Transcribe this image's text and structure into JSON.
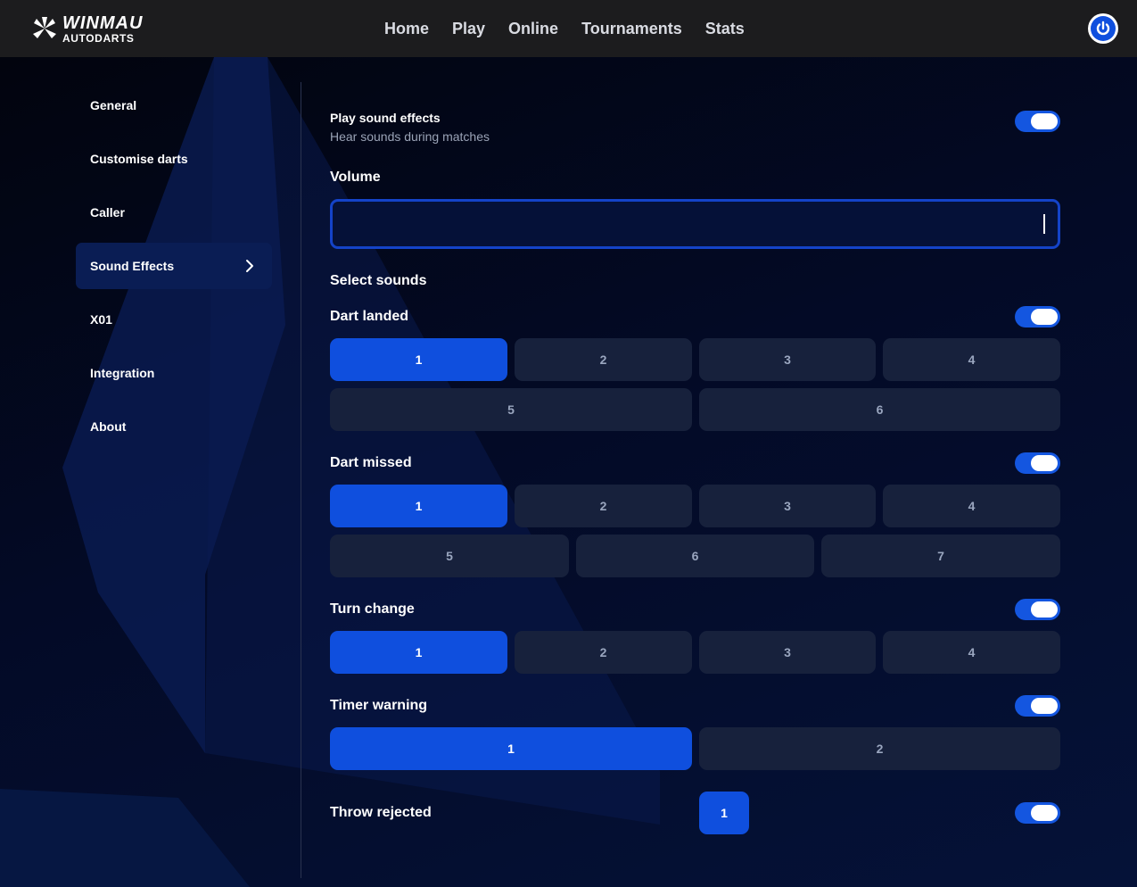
{
  "header": {
    "brand": "WINMAU",
    "brand_sub": "AUTODARTS",
    "nav": [
      "Home",
      "Play",
      "Online",
      "Tournaments",
      "Stats"
    ]
  },
  "sidebar": {
    "items": [
      {
        "label": "General"
      },
      {
        "label": "Customise darts"
      },
      {
        "label": "Caller"
      },
      {
        "label": "Sound Effects",
        "active": true
      },
      {
        "label": "X01"
      },
      {
        "label": "Integration"
      },
      {
        "label": "About"
      }
    ]
  },
  "settings": {
    "play_sound_effects": {
      "label": "Play sound effects",
      "description": "Hear sounds during matches",
      "enabled": true
    },
    "volume": {
      "label": "Volume",
      "value": ""
    },
    "select_sounds_label": "Select sounds",
    "sounds": [
      {
        "label": "Dart landed",
        "enabled": true,
        "options": [
          "1",
          "2",
          "3",
          "4",
          "5",
          "6"
        ],
        "selected": "1"
      },
      {
        "label": "Dart missed",
        "enabled": true,
        "options": [
          "1",
          "2",
          "3",
          "4",
          "5",
          "6",
          "7"
        ],
        "selected": "1"
      },
      {
        "label": "Turn change",
        "enabled": true,
        "options": [
          "1",
          "2",
          "3",
          "4"
        ],
        "selected": "1"
      },
      {
        "label": "Timer warning",
        "enabled": true,
        "options": [
          "1",
          "2"
        ],
        "selected": "1"
      },
      {
        "label": "Throw rejected",
        "enabled": true,
        "options": [
          "1"
        ],
        "selected": "1"
      }
    ]
  },
  "colors": {
    "accent": "#0f4fde",
    "header_bg": "#1c1c1e",
    "option_bg": "#17213c",
    "toggle_on": "#1456e0"
  }
}
